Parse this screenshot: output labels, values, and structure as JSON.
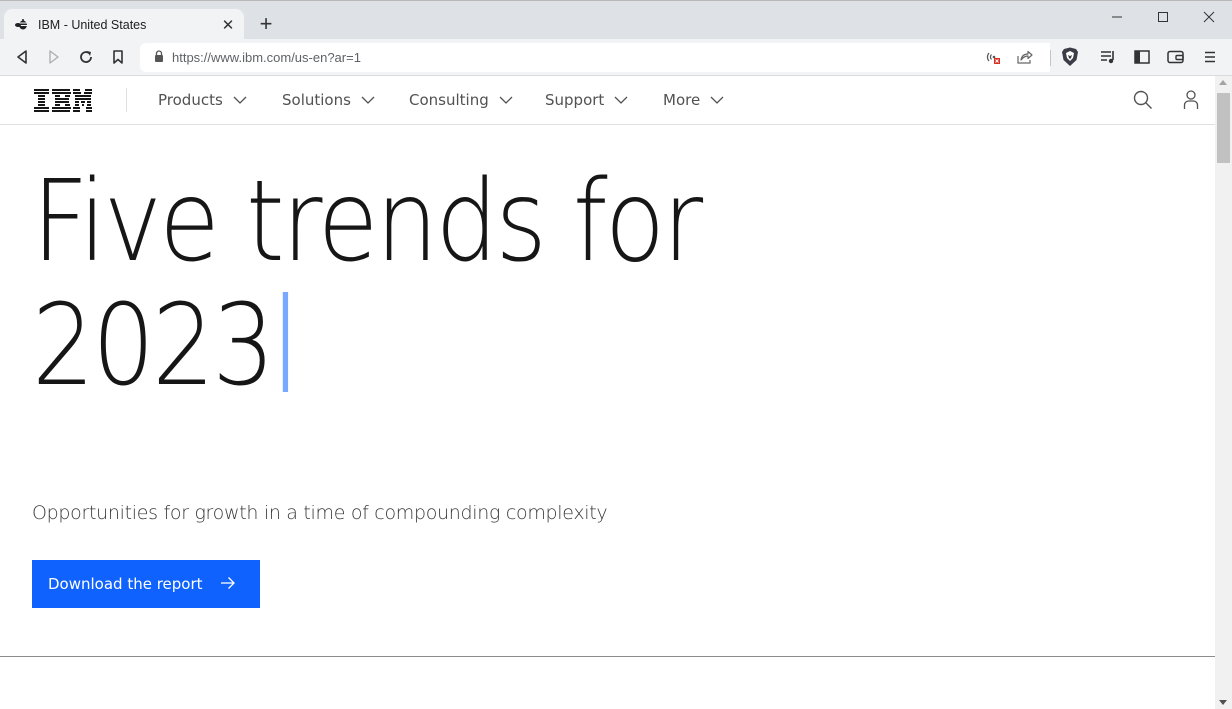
{
  "browser": {
    "tab": {
      "title": "IBM - United States",
      "favicon": "ibm-bee-icon",
      "close_glyph": "✕"
    },
    "new_tab_glyph": "+",
    "window_controls": {
      "minimize": "minimize-icon",
      "maximize": "maximize-icon",
      "close": "close-icon"
    },
    "nav": {
      "back": "back-icon",
      "forward": "forward-icon",
      "reload": "reload-icon",
      "bookmark": "bookmark-icon"
    },
    "address_bar": {
      "url": "https://www.ibm.com/us-en?ar=1",
      "security": "lock-icon"
    },
    "right_icons": [
      "media-blocked-icon",
      "share-icon",
      "brave-shields-icon",
      "playlist-icon",
      "sidebar-icon",
      "wallet-icon",
      "menu-icon"
    ]
  },
  "masthead": {
    "logo": "IBM",
    "nav_items": [
      {
        "label": "Products"
      },
      {
        "label": "Solutions"
      },
      {
        "label": "Consulting"
      },
      {
        "label": "Support"
      },
      {
        "label": "More"
      }
    ],
    "icons": [
      "search-icon",
      "user-icon"
    ]
  },
  "hero": {
    "title_line1": "Five trends for",
    "title_line2": "2023",
    "subtitle": "Opportunities for growth in a time of compounding complexity",
    "cta_label": "Download the report",
    "cta_color": "#0f62fe",
    "caret_color": "#78a9ff"
  }
}
